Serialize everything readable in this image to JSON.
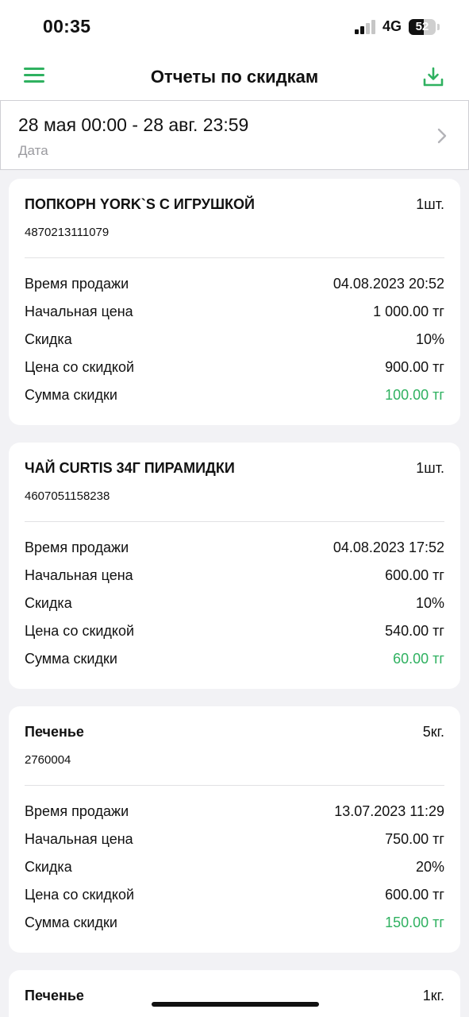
{
  "status_bar": {
    "time": "00:35",
    "network": "4G",
    "battery": "52"
  },
  "header": {
    "title": "Отчеты по скидкам"
  },
  "date_filter": {
    "value": "28 мая 00:00 - 28 авг. 23:59",
    "label": "Дата"
  },
  "colors": {
    "accent": "#2fb160",
    "background": "#f2f2f5"
  },
  "icons": {
    "menu": "hamburger-menu-icon",
    "download": "download-icon",
    "chevron": "chevron-right-icon"
  },
  "field_labels": {
    "sale_time": "Время продажи",
    "initial_price": "Начальная цена",
    "discount": "Скидка",
    "discounted_price": "Цена со скидкой",
    "discount_sum": "Сумма скидки"
  },
  "items": [
    {
      "name": "ПОПКОРН YORK`S С ИГРУШКОЙ",
      "qty": "1шт.",
      "code": "4870213111079",
      "sale_time": "04.08.2023 20:52",
      "initial_price": "1 000.00 тг",
      "discount": "10%",
      "discounted_price": "900.00 тг",
      "discount_sum": "100.00 тг"
    },
    {
      "name": "ЧАЙ CURTIS 34Г ПИРАМИДКИ",
      "qty": "1шт.",
      "code": "4607051158238",
      "sale_time": "04.08.2023 17:52",
      "initial_price": "600.00 тг",
      "discount": "10%",
      "discounted_price": "540.00 тг",
      "discount_sum": "60.00 тг"
    },
    {
      "name": "Печенье",
      "qty": "5кг.",
      "code": "2760004",
      "sale_time": "13.07.2023 11:29",
      "initial_price": "750.00 тг",
      "discount": "20%",
      "discounted_price": "600.00 тг",
      "discount_sum": "150.00 тг"
    },
    {
      "name": "Печенье",
      "qty": "1кг."
    }
  ]
}
